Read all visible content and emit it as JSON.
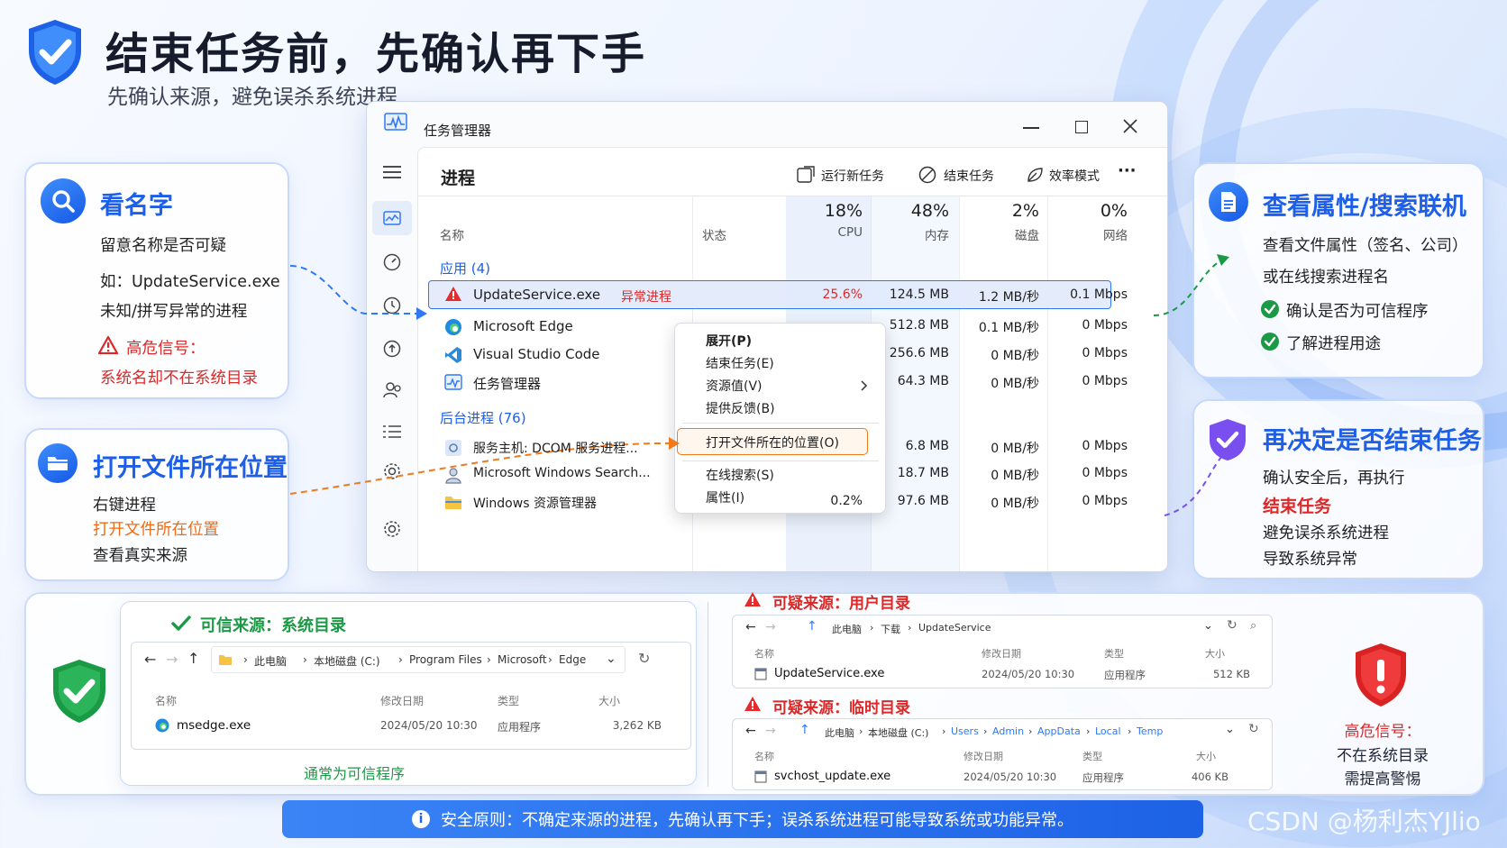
{
  "header": {
    "title": "结束任务前，先确认再下手",
    "subtitle": "先确认来源，避免误杀系统进程"
  },
  "colors": {
    "accent": "#1d5fe8",
    "danger": "#dc2828",
    "warn": "#f06a10",
    "ok": "#1b9a45"
  },
  "card_name": {
    "title": "看名字",
    "l1": "留意名称是否可疑",
    "l2": "如：UpdateService.exe",
    "l3": "未知/拼写异常的进程",
    "warn": "高危信号：",
    "warn2": "系统名却不在系统目录",
    "icon": "search-icon"
  },
  "card_loc": {
    "title": "打开文件所在位置",
    "l1": "右键进程",
    "l2": "打开文件所在位置",
    "l3": "查看真实来源",
    "icon": "folder-icon"
  },
  "card_prop": {
    "title": "查看属性/搜索联机",
    "l1": "查看文件属性（签名、公司）",
    "l2": "或在线搜索进程名",
    "c1": "确认是否为可信程序",
    "c2": "了解进程用途",
    "icon": "document-icon"
  },
  "card_decide": {
    "title": "再决定是否结束任务",
    "l1": "确认安全后，再执行",
    "l2": "结束任务",
    "l3": "避免误杀系统进程",
    "l4": "导致系统异常",
    "icon": "shield-check-icon"
  },
  "tm": {
    "title": "任务管理器",
    "page": "进程",
    "toolbar": {
      "run": "运行新任务",
      "end": "结束任务",
      "eff": "效率模式",
      "more": "···"
    },
    "cols": {
      "name": "名称",
      "status": "状态",
      "cpu_pct": "18%",
      "cpu": "CPU",
      "mem_pct": "48%",
      "mem": "内存",
      "disk_pct": "2%",
      "disk": "磁盘",
      "net_pct": "0%",
      "net": "网络"
    },
    "apps_header": "应用 (4)",
    "apps": [
      {
        "name": "UpdateService.exe",
        "status": "异常进程",
        "cpu": "25.6%",
        "mem": "124.5 MB",
        "disk": "1.2 MB/秒",
        "net": "0.1 Mbps",
        "icon": "warning-icon"
      },
      {
        "name": "Microsoft Edge",
        "status": "",
        "cpu": "",
        "mem": "512.8 MB",
        "disk": "0.1 MB/秒",
        "net": "0 Mbps",
        "icon": "edge-icon"
      },
      {
        "name": "Visual Studio Code",
        "status": "",
        "cpu": "",
        "mem": "256.6 MB",
        "disk": "0 MB/秒",
        "net": "0 Mbps",
        "icon": "vscode-icon"
      },
      {
        "name": "任务管理器",
        "status": "",
        "cpu": "",
        "mem": "64.3 MB",
        "disk": "0 MB/秒",
        "net": "0 Mbps",
        "icon": "taskmanager-icon"
      }
    ],
    "bg_header": "后台进程 (76)",
    "bg": [
      {
        "name": "服务主机: DCOM 服务进程...",
        "cpu": "",
        "mem": "6.8 MB",
        "disk": "0 MB/秒",
        "net": "0 Mbps",
        "icon": "gear-icon"
      },
      {
        "name": "Microsoft Windows Search...",
        "cpu": "",
        "mem": "18.7 MB",
        "disk": "0 MB/秒",
        "net": "0 Mbps",
        "icon": "search-user-icon"
      },
      {
        "name": "Windows 资源管理器",
        "cpu": "0.2%",
        "mem": "97.6 MB",
        "disk": "0 MB/秒",
        "net": "0 Mbps",
        "icon": "folder-icon"
      }
    ],
    "menu": [
      "展开(P)",
      "结束任务(E)",
      "资源值(V)",
      "提供反馈(B)",
      "打开文件所在的位置(O)",
      "在线搜索(S)",
      "属性(I)"
    ]
  },
  "trusted": {
    "title": "可信来源：系统目录",
    "path": [
      "此电脑",
      "本地磁盘 (C:)",
      "Program Files",
      "Microsoft",
      "Edge"
    ],
    "cols": [
      "名称",
      "修改日期",
      "类型",
      "大小"
    ],
    "row": {
      "name": "msedge.exe",
      "date": "2024/05/20 10:30",
      "type": "应用程序",
      "size": "3,262 KB"
    },
    "note": "通常为可信程序"
  },
  "sus1": {
    "title": "可疑来源：用户目录",
    "path": [
      "此电脑",
      "下载",
      "UpdateService"
    ],
    "cols": [
      "名称",
      "修改日期",
      "类型",
      "大小"
    ],
    "row": {
      "name": "UpdateService.exe",
      "date": "2024/05/20 10:30",
      "type": "应用程序",
      "size": "512 KB"
    }
  },
  "sus2": {
    "title": "可疑来源：临时目录",
    "path": [
      "此电脑",
      "本地磁盘 (C:)",
      "Users",
      "Admin",
      "AppData",
      "Local",
      "Temp"
    ],
    "cols": [
      "名称",
      "修改日期",
      "类型",
      "大小"
    ],
    "row": {
      "name": "svchost_update.exe",
      "date": "2024/05/20 10:30",
      "type": "应用程序",
      "size": "406 KB"
    }
  },
  "danger": {
    "l1": "高危信号：",
    "l2": "不在系统目录",
    "l3": "需提高警惕"
  },
  "banner": "安全原则：不确定来源的进程，先确认再下手；误杀系统进程可能导致系统或功能异常。",
  "watermark": "CSDN @杨利杰YJlio"
}
